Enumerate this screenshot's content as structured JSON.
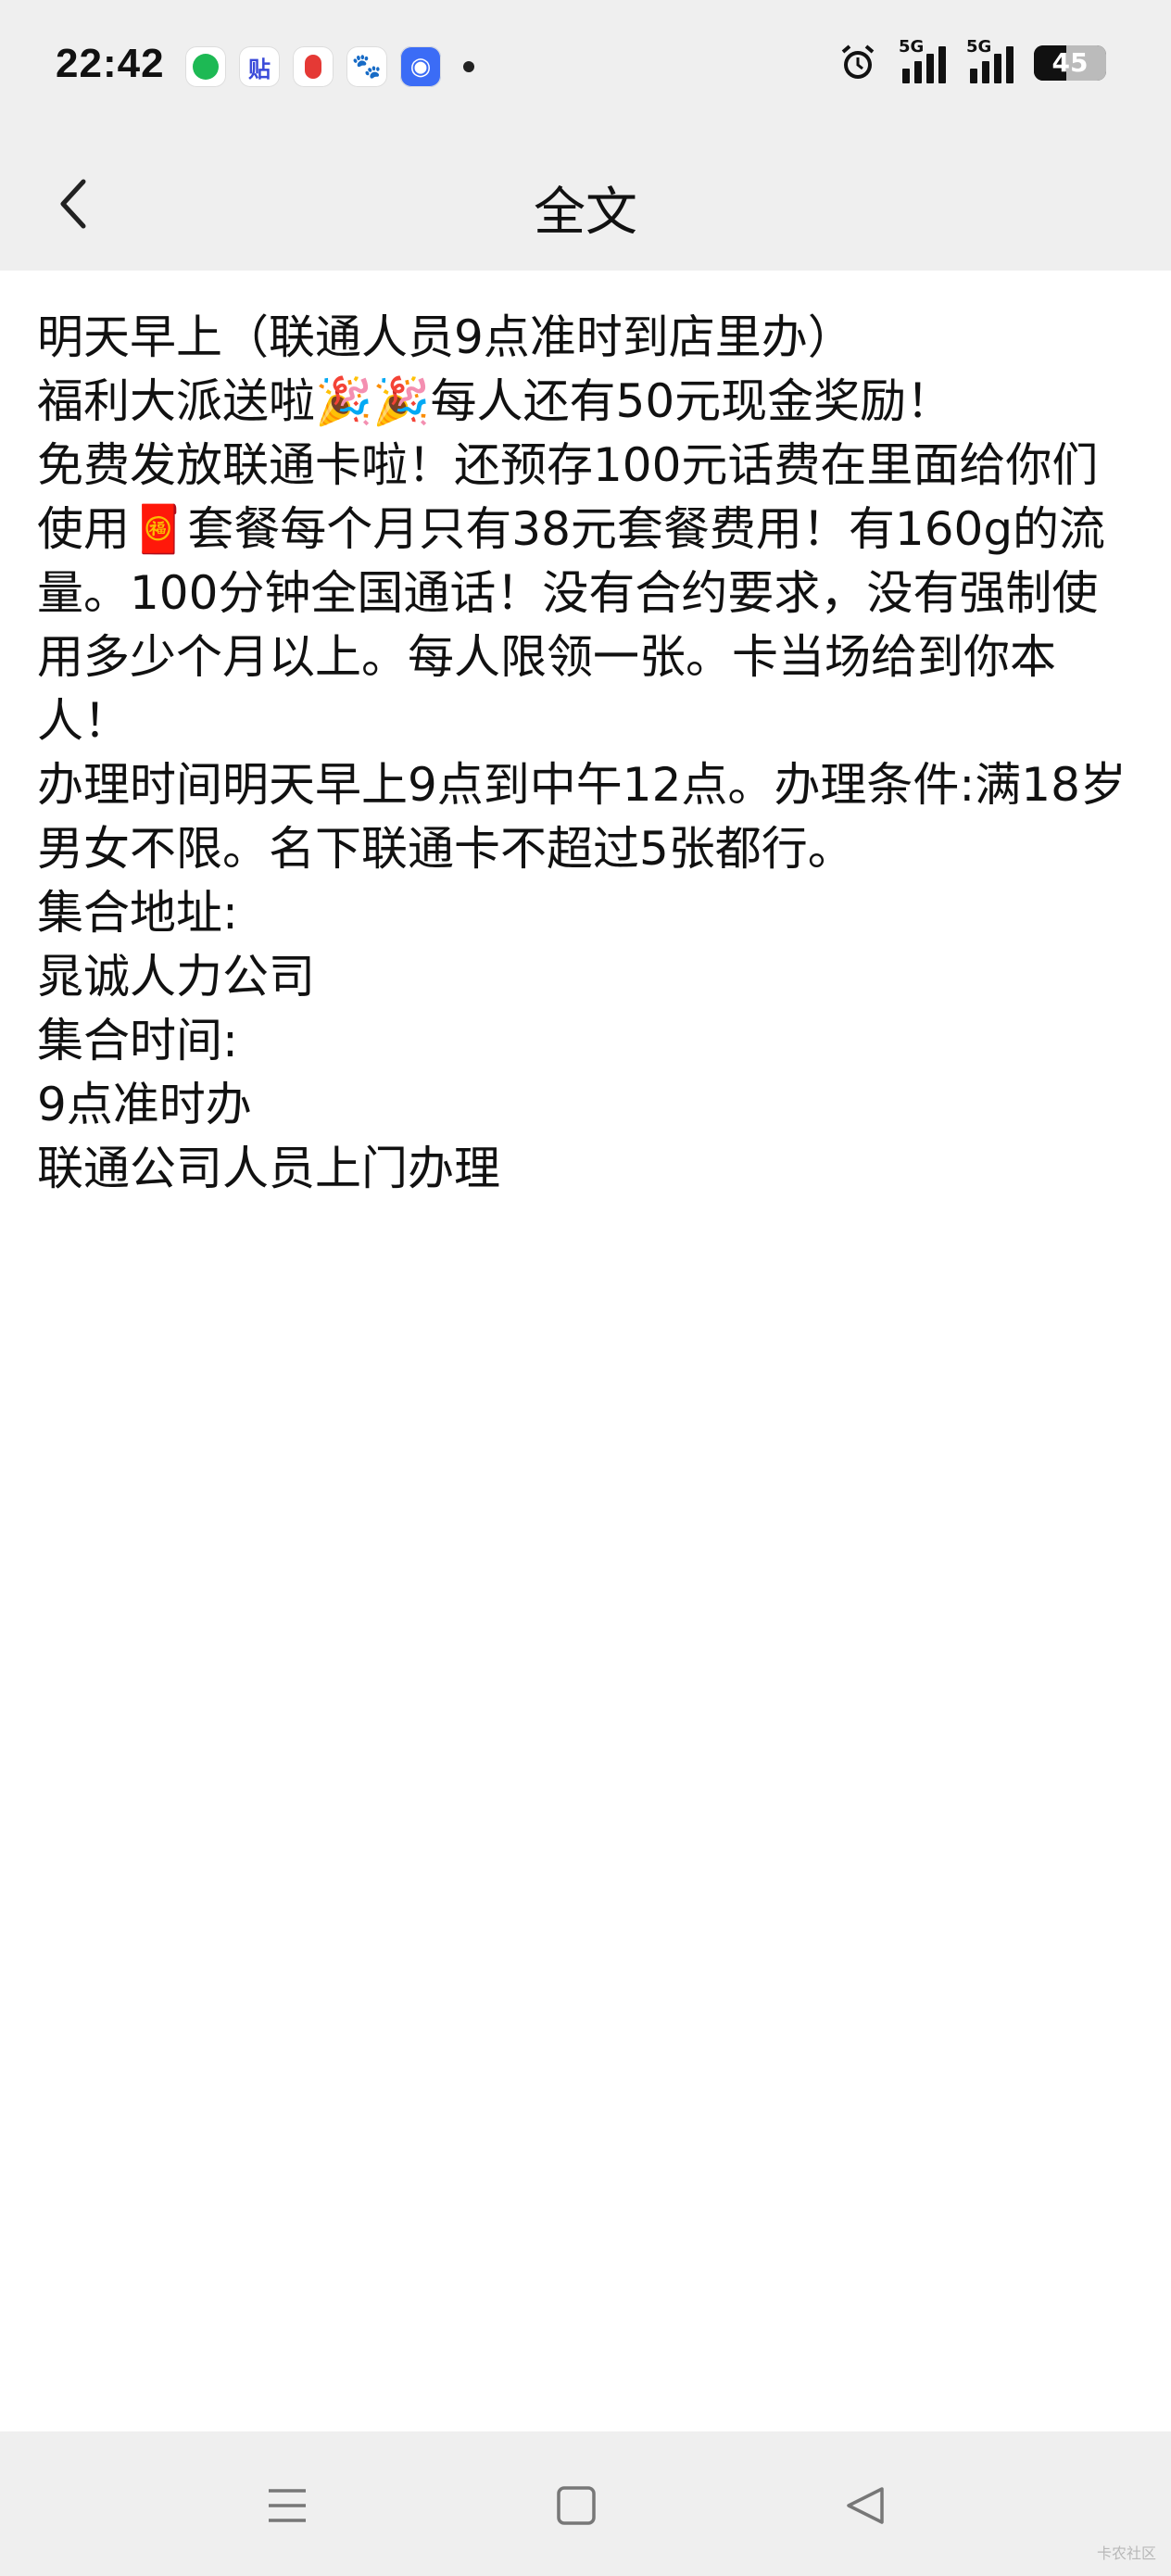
{
  "status_bar": {
    "time": "22:42",
    "app_icons": [
      "chat-app-icon",
      "tieba-icon",
      "map-pin-icon",
      "baidu-icon",
      "qq-icon"
    ],
    "network_1": "5G",
    "network_2": "5G",
    "battery": "45"
  },
  "header": {
    "title": "全文"
  },
  "post": {
    "lines": [
      "明天早上（联通人员9点准时到店里办）",
      "福利大派送啦🎉🎉每人还有50元现金奖励！",
      "免费发放联通卡啦！还预存100元话费在里面给你们使用🧧套餐每个月只有38元套餐费用！有160g的流量。100分钟全国通话！没有合约要求，没有强制使用多少个月以上。每人限领一张。卡当场给到你本人！",
      "办理时间明天早上9点到中午12点。办理条件:满18岁男女不限。名下联通卡不超过5张都行。",
      "集合地址:",
      "晁诚人力公司",
      "集合时间:",
      "9点准时办",
      "联通公司人员上门办理"
    ]
  },
  "nav": {
    "menu": "menu-icon",
    "home": "home-icon",
    "back": "back-triangle-icon"
  },
  "watermark": "卡农社区"
}
